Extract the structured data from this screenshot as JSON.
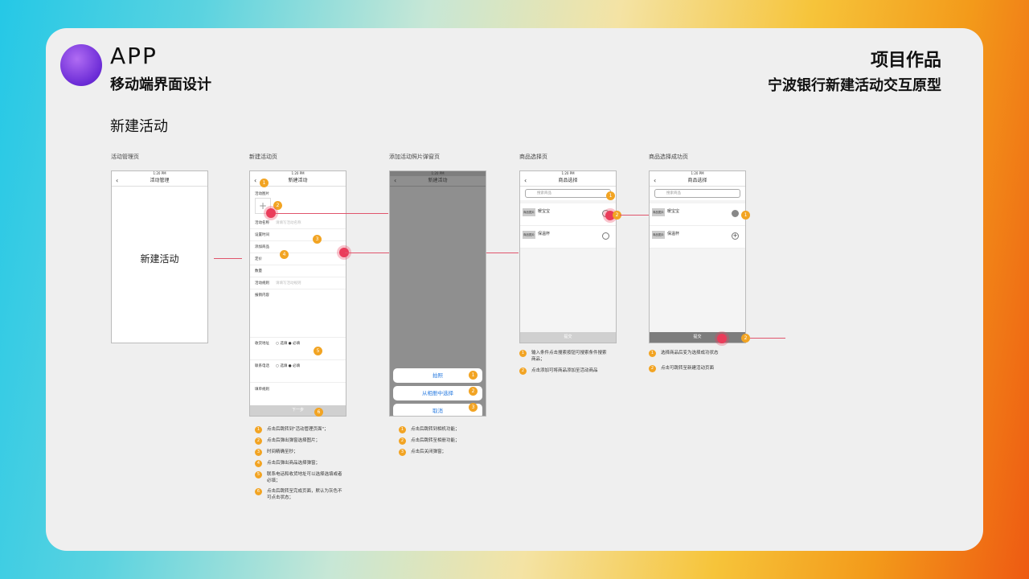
{
  "header": {
    "app": "APP",
    "subtitle": "移动端界面设计",
    "right_title": "项目作品",
    "right_subtitle": "宁波银行新建活动交互原型",
    "section": "新建活动"
  },
  "screens": {
    "s1": {
      "label": "活动管理页",
      "title": "活动管理",
      "center": "新建活动"
    },
    "s2": {
      "label": "新建活动页",
      "title": "新建活动",
      "rows": [
        "活动图片",
        "活动名称",
        "设置时间",
        "添加商品",
        "定价",
        "数量",
        "活动规则",
        "报销内容",
        "收货地址",
        "联系电话",
        "填单规则"
      ],
      "next": "下一步"
    },
    "s3": {
      "label": "添加活动照片弹窗页",
      "title": "新建活动",
      "opt1": "拍照",
      "opt2": "从相册中选择",
      "cancel": "取消"
    },
    "s4": {
      "label": "商品选择页",
      "title": "商品选择",
      "search": "搜索商品",
      "item1": "暖宝宝",
      "item2": "保温杯",
      "submit": "提交"
    },
    "s5": {
      "label": "商品选择成功页",
      "title": "商品选择",
      "search": "搜索商品",
      "item1": "暖宝宝",
      "item2": "保温杯",
      "submit": "提交"
    }
  },
  "notes2": [
    "点击后跳转到\"活动管理页面\"；",
    "点击后弹出弹窗选择图片；",
    "时间精确至秒；",
    "点击后弹出商品选择弹窗；",
    "联系电话和收货地址可以选择选填或者必填；",
    "点击后跳转至完成页面，默认为灰色不可点击状态；"
  ],
  "notes3": [
    "点击后跳转到相机功能；",
    "点击后跳转至相册功能；",
    "点击后关闭弹窗；"
  ],
  "notes4": [
    "输入条件点击搜索按钮可搜索条件搜索商品；",
    "点击添加可将商品添加至活动商品"
  ],
  "notes5": [
    "选择商品后变为选择成功状态",
    "点击可跳转至新建活动页面"
  ]
}
